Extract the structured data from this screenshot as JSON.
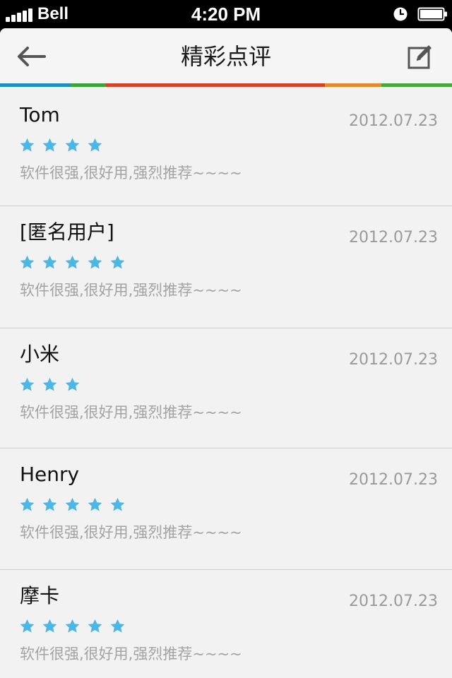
{
  "status_bar": {
    "carrier": "Bell",
    "time": "4:20 PM"
  },
  "nav": {
    "title": "精彩点评",
    "back_icon": "arrow-left-icon",
    "edit_icon": "compose-icon"
  },
  "colors": {
    "star": "#4cb6e4",
    "strip": [
      "#1f8fc3",
      "#3aa339",
      "#d2432a",
      "#e38b2a",
      "#46a83c"
    ]
  },
  "reviews": [
    {
      "name": "Tom",
      "date": "2012.07.23",
      "rating": 4,
      "text": "软件很强,很好用,强烈推荐~~~~"
    },
    {
      "name": "[匿名用户]",
      "date": "2012.07.23",
      "rating": 5,
      "text": "软件很强,很好用,强烈推荐~~~~"
    },
    {
      "name": "小米",
      "date": "2012.07.23",
      "rating": 3,
      "text": "软件很强,很好用,强烈推荐~~~~"
    },
    {
      "name": "Henry",
      "date": "2012.07.23",
      "rating": 5,
      "text": "软件很强,很好用,强烈推荐~~~~"
    },
    {
      "name": "摩卡",
      "date": "2012.07.23",
      "rating": 5,
      "text": "软件很强,很好用,强烈推荐~~~~"
    }
  ]
}
